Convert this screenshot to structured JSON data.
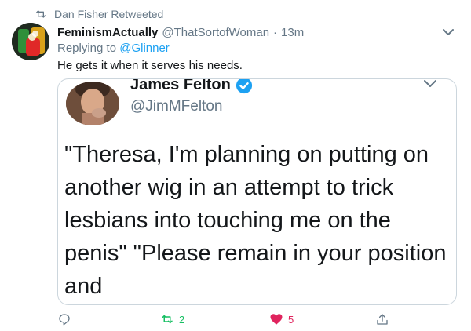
{
  "retweet_context": {
    "icon": "retweet-icon",
    "text": "Dan Fisher Retweeted"
  },
  "tweet": {
    "display_name": "FeminismActually",
    "handle": "@ThatSortofWoman",
    "separator": "·",
    "time": "13m",
    "replying_prefix": "Replying to",
    "replying_to": "@Glinner",
    "text": "He gets it when it serves his needs."
  },
  "quoted_tweet": {
    "display_name": "James Felton",
    "handle": "@JimMFelton",
    "verified": true,
    "text": "\"Theresa, I'm planning on putting on another wig in an attempt to trick lesbians into touching me on the penis\" \"Please remain in your position and"
  },
  "actions": {
    "reply_count": "",
    "retweet_count": "2",
    "like_count": "5",
    "liked": true,
    "retweeted": false
  },
  "colors": {
    "link": "#1da1f2",
    "muted": "#657786",
    "like": "#e0245e",
    "retweet": "#17bf63",
    "border": "#ccd6dd"
  }
}
